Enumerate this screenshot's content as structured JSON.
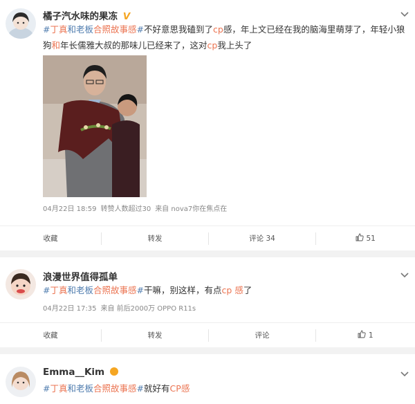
{
  "colors": {
    "accent": "#eb7350",
    "link": "#507daf",
    "vip": "#f5a623",
    "background": "#f2f2f2"
  },
  "posts": [
    {
      "user": "橘子汽水味的果冻",
      "verified_badge": "V",
      "text": {
        "tag_open": "#",
        "tag_a": "丁真",
        "tag_b": "和老板",
        "tag_c": "合照故事",
        "tag_d": "感",
        "tag_close": "#",
        "body1": "不好意思我磕到了",
        "cp": "cp",
        "body2": "感，年上文已经在我的脑海里萌芽了，年轻小狼狗",
        "he": "和",
        "body3": "年长儒雅大叔的那味儿已经来了，这对",
        "cp2": "cp",
        "body4": "我上头了"
      },
      "meta": {
        "date": "04月22日 18:59",
        "extra": "转赞人数超过30",
        "source": "来自 nova7你在焦点在"
      },
      "actions": {
        "favorite": "收藏",
        "repost": "转发",
        "comment": "评论 34",
        "like": "51"
      }
    },
    {
      "user": "浪漫世界值得孤单",
      "text": {
        "tag_open": "#",
        "tag_a": "丁真",
        "tag_b": "和老板",
        "tag_c": "合照故事",
        "tag_d": "感",
        "tag_close": "#",
        "body1": "干嘛，别这样，有点",
        "cp": "cp",
        "body2": " ",
        "gan": "感",
        "body3": "了"
      },
      "meta": {
        "date": "04月22日 17:35",
        "source": "来自 前后2000万 OPPO R11s"
      },
      "actions": {
        "favorite": "收藏",
        "repost": "转发",
        "comment": "评论",
        "like": "1"
      }
    },
    {
      "user": "Emma__Kim",
      "text": {
        "tag_open": "#",
        "tag_a": "丁真",
        "tag_b": "和老板",
        "tag_c": "合照故事",
        "tag_d": "感",
        "tag_close": "#",
        "body1": "就好有",
        "cp": "CP",
        "gan": "感"
      }
    }
  ]
}
